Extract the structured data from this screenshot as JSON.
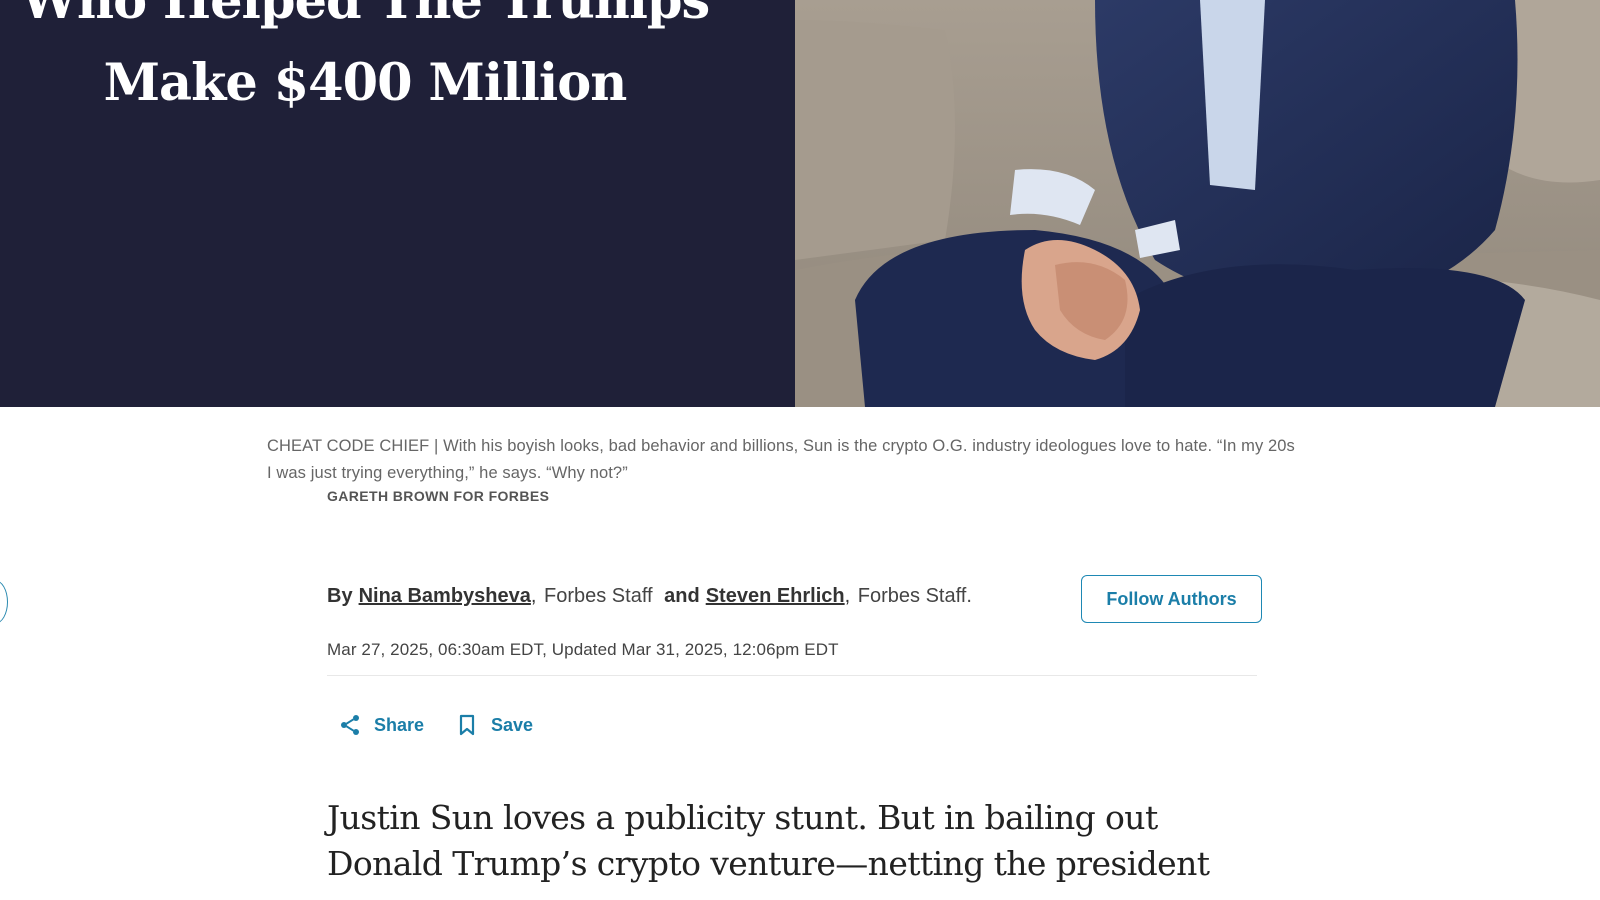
{
  "article": {
    "title_lines": [
      "Who Helped The Trumps",
      "Make $400 Million"
    ],
    "caption": "CHEAT CODE CHIEF | With his boyish looks, bad behavior and billions, Sun is the crypto O.G. industry ideologues love to hate. “In my 20s I was just trying everything,” he says. “Why not?”",
    "photo_credit": "GARETH BROWN FOR FORBES",
    "byline": {
      "by": "By",
      "authors": [
        {
          "name": "Nina Bambysheva",
          "role": "Forbes Staff"
        },
        {
          "name": "Steven Ehrlich",
          "role": "Forbes Staff."
        }
      ],
      "conjunction": "and"
    },
    "follow_label": "Follow Authors",
    "dateline": "Mar 27, 2025, 06:30am EDT, Updated Mar 31, 2025, 12:06pm EDT",
    "actions": {
      "share": "Share",
      "save": "Save"
    },
    "lede_lines": [
      "Justin Sun loves a publicity stunt. But in bailing out",
      "Donald Trump’s crypto venture—netting the president"
    ]
  },
  "colors": {
    "hero_bg": "#1f2038",
    "accent": "#1b7ea8"
  },
  "icons": {
    "share": "share-icon",
    "save": "bookmark-icon"
  }
}
